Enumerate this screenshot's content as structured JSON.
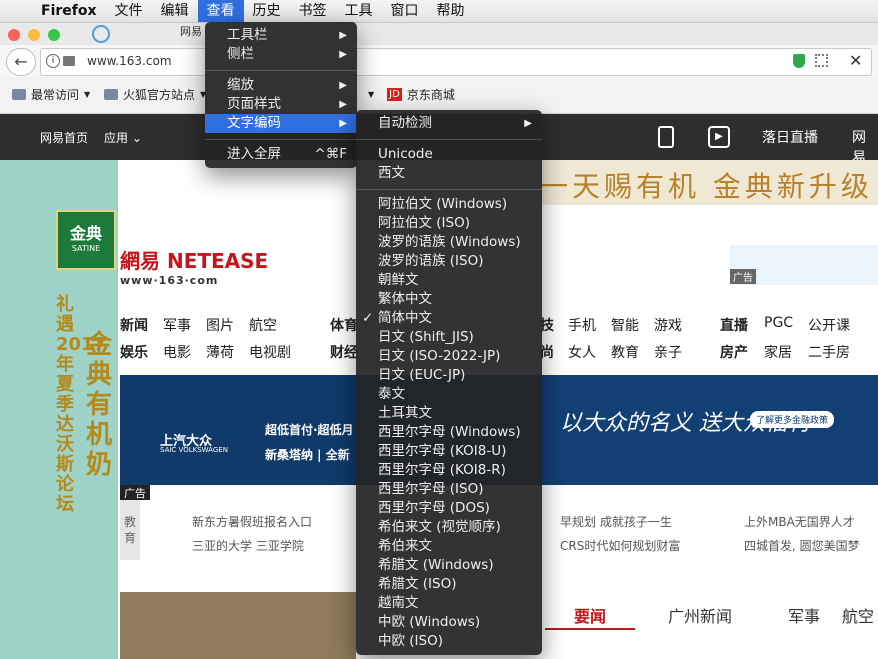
{
  "menubar": {
    "app": "Firefox",
    "items": [
      "文件",
      "编辑",
      "查看",
      "历史",
      "书签",
      "工具",
      "窗口",
      "帮助"
    ],
    "active": "查看"
  },
  "browser": {
    "tab_title": "网易",
    "url": "www.163.com",
    "bookmarks": [
      "最常访问",
      "火狐官方站点",
      "京东商城"
    ],
    "jd_badge": "JD"
  },
  "site_nav": {
    "items": [
      "网易首页",
      "应用",
      "网易"
    ],
    "live": "落日直播"
  },
  "view_menu": {
    "items": [
      {
        "label": "工具栏",
        "submenu": true
      },
      {
        "label": "侧栏",
        "submenu": true
      },
      {
        "label": "缩放",
        "submenu": true
      },
      {
        "label": "页面样式",
        "submenu": true
      },
      {
        "label": "文字编码",
        "submenu": true,
        "highlighted": true
      },
      {
        "label": "进入全屏",
        "shortcut": "^⌘F"
      }
    ]
  },
  "encoding_menu": {
    "auto": "自动检测",
    "group1": [
      "Unicode",
      "西文"
    ],
    "group2": [
      "阿拉伯文 (Windows)",
      "阿拉伯文 (ISO)",
      "波罗的语族 (Windows)",
      "波罗的语族 (ISO)",
      "朝鲜文",
      "繁体中文",
      "简体中文",
      "日文 (Shift_JIS)",
      "日文 (ISO-2022-JP)",
      "日文 (EUC-JP)",
      "泰文",
      "土耳其文",
      "西里尔字母 (Windows)",
      "西里尔字母 (KOI8-U)",
      "西里尔字母 (KOI8-R)",
      "西里尔字母 (ISO)",
      "西里尔字母 (DOS)",
      "希伯来文 (视觉顺序)",
      "希伯来文",
      "希腊文 (Windows)",
      "希腊文 (ISO)",
      "越南文",
      "中欧 (Windows)",
      "中欧 (ISO)"
    ],
    "checked": "简体中文"
  },
  "page": {
    "brand_name": "金典",
    "brand_sub": "SATINE",
    "ad_vertical_1": "金典有机奶",
    "ad_vertical_2": "礼遇2017年夏季达沃斯论坛",
    "banner_text": "一天赐有机 金典新升级",
    "logo": "網易 NETEASE",
    "logo_url": "www·163·com",
    "ad_label": "广告",
    "nav_row1": [
      "新闻",
      "军事",
      "图片",
      "航空",
      "体育",
      "技",
      "手机",
      "智能",
      "游戏",
      "直播",
      "PGC",
      "公开课"
    ],
    "nav_row2": [
      "娱乐",
      "电影",
      "薄荷",
      "电视剧",
      "财经",
      "尚",
      "女人",
      "教育",
      "亲子",
      "房产",
      "家居",
      "二手房"
    ],
    "hero_brand": "上汽大众",
    "hero_brand_en": "SAIC VOLKSWAGEN",
    "hero_line1": "超低首付·超低月",
    "hero_line2": "新桑塔纳 | 全新",
    "hero_slogan": "以大众的名义 送大众福利",
    "hero_cta": "了解更多金融政策",
    "edu_tag": "教育",
    "edu_links": [
      "新东方暑假班报名入口",
      "三亚的大学 三亚学院",
      "早规划 成就孩子一生",
      "CRS时代如何规划财富",
      "上外MBA无国界人才",
      "四城首发, 圆您美国梦"
    ],
    "news_tabs": [
      "要闻",
      "广州新闻",
      "军事",
      "航空"
    ],
    "colors": {
      "accent": "#2f6fe0",
      "news_red": "#c4161c"
    }
  }
}
